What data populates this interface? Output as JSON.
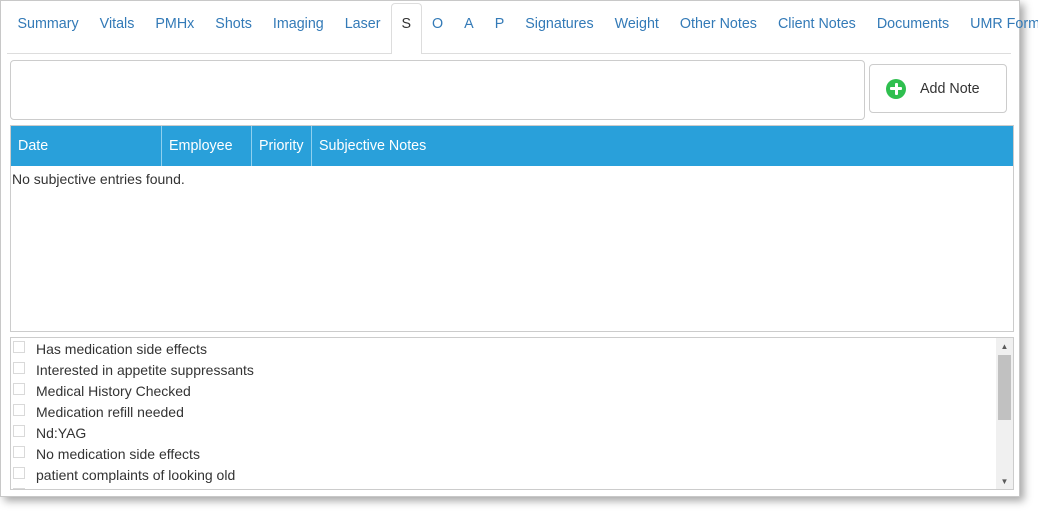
{
  "tabs": [
    {
      "label": "Summary",
      "active": false
    },
    {
      "label": "Vitals",
      "active": false
    },
    {
      "label": "PMHx",
      "active": false
    },
    {
      "label": "Shots",
      "active": false
    },
    {
      "label": "Imaging",
      "active": false
    },
    {
      "label": "Laser",
      "active": false
    },
    {
      "label": "S",
      "active": true
    },
    {
      "label": "O",
      "active": false
    },
    {
      "label": "A",
      "active": false
    },
    {
      "label": "P",
      "active": false
    },
    {
      "label": "Signatures",
      "active": false
    },
    {
      "label": "Weight",
      "active": false
    },
    {
      "label": "Other Notes",
      "active": false
    },
    {
      "label": "Client Notes",
      "active": false
    },
    {
      "label": "Documents",
      "active": false
    },
    {
      "label": "UMR Forms",
      "active": false
    }
  ],
  "note": {
    "input_value": "",
    "add_button_label": "Add Note",
    "add_icon": "plus-circle-icon"
  },
  "grid": {
    "columns": [
      "Date",
      "Employee",
      "Priority",
      "Subjective Notes"
    ],
    "empty_message": "No subjective entries found.",
    "header_color": "#29a0da"
  },
  "checklist": {
    "items": [
      {
        "label": "Has medication side effects",
        "checked": false
      },
      {
        "label": "Interested in appetite suppressants",
        "checked": false
      },
      {
        "label": "Medical History Checked",
        "checked": false
      },
      {
        "label": "Medication refill needed",
        "checked": false
      },
      {
        "label": "Nd:YAG",
        "checked": false
      },
      {
        "label": "No medication side effects",
        "checked": false
      },
      {
        "label": "patient complaints of looking old",
        "checked": false
      }
    ]
  }
}
